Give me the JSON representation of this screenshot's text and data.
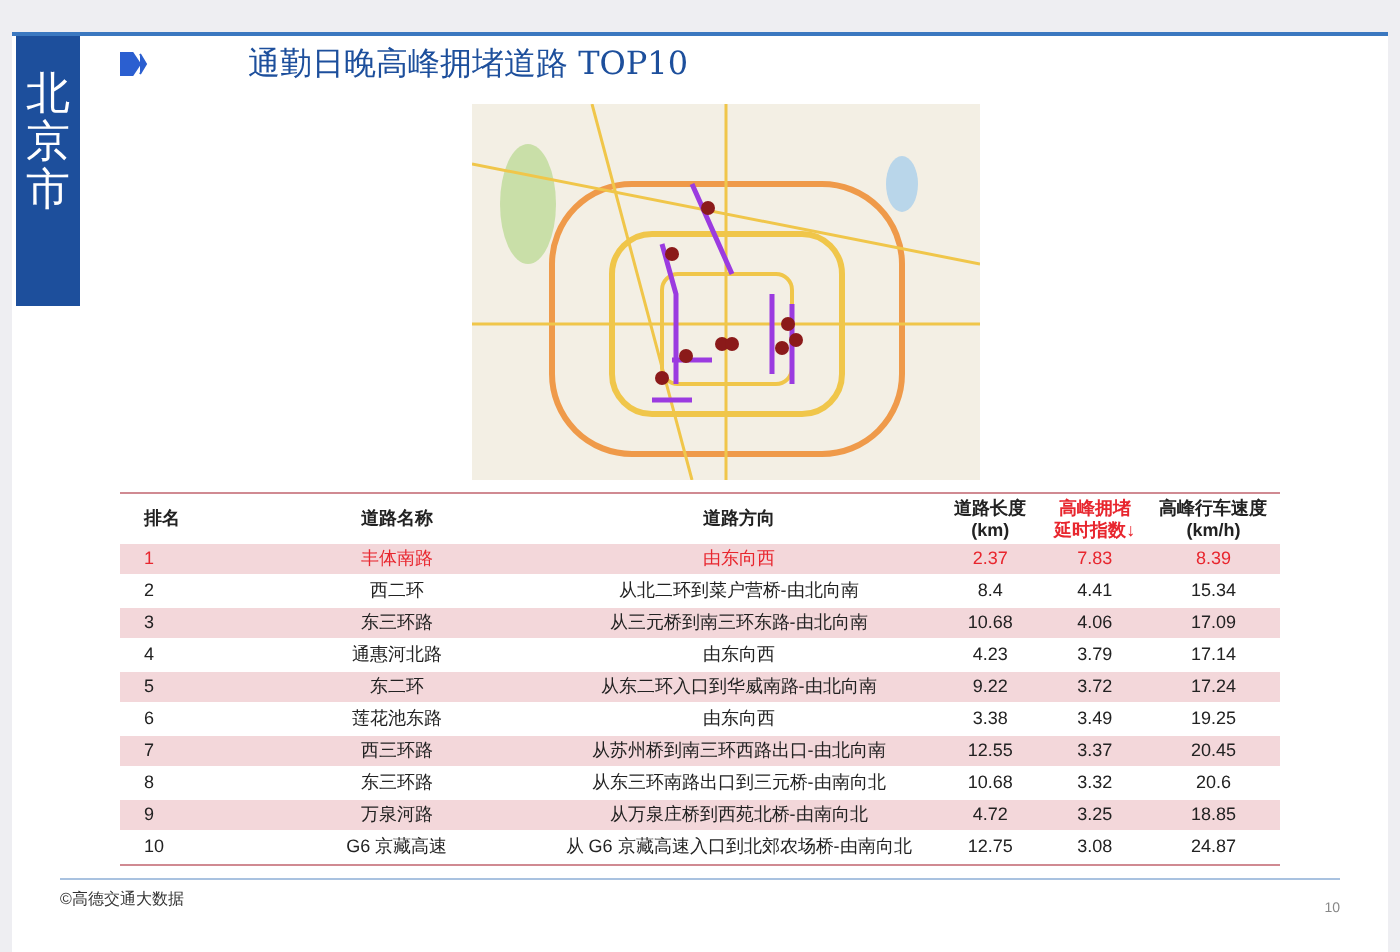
{
  "sidebar": {
    "city": "北京市"
  },
  "title": "通勤日晚高峰拥堵道路 TOP10",
  "table": {
    "columns": [
      {
        "lines": [
          "排名"
        ],
        "highlighted": false
      },
      {
        "lines": [
          "道路名称"
        ],
        "highlighted": false
      },
      {
        "lines": [
          "道路方向"
        ],
        "highlighted": false
      },
      {
        "lines": [
          "道路长度",
          "(km)"
        ],
        "highlighted": false
      },
      {
        "lines": [
          "高峰拥堵",
          "延时指数↓"
        ],
        "highlighted": true
      },
      {
        "lines": [
          "高峰行车速度",
          "(km/h)"
        ],
        "highlighted": false
      }
    ],
    "rows": [
      {
        "highlighted": true,
        "cells": [
          "1",
          "丰体南路",
          "由东向西",
          "2.37",
          "7.83",
          "8.39"
        ]
      },
      {
        "highlighted": false,
        "cells": [
          "2",
          "西二环",
          "从北二环到菜户营桥-由北向南",
          "8.4",
          "4.41",
          "15.34"
        ]
      },
      {
        "highlighted": false,
        "cells": [
          "3",
          "东三环路",
          "从三元桥到南三环东路-由北向南",
          "10.68",
          "4.06",
          "17.09"
        ]
      },
      {
        "highlighted": false,
        "cells": [
          "4",
          "通惠河北路",
          "由东向西",
          "4.23",
          "3.79",
          "17.14"
        ]
      },
      {
        "highlighted": false,
        "cells": [
          "5",
          "东二环",
          "从东二环入口到华威南路-由北向南",
          "9.22",
          "3.72",
          "17.24"
        ]
      },
      {
        "highlighted": false,
        "cells": [
          "6",
          "莲花池东路",
          "由东向西",
          "3.38",
          "3.49",
          "19.25"
        ]
      },
      {
        "highlighted": false,
        "cells": [
          "7",
          "西三环路",
          "从苏州桥到南三环西路出口-由北向南",
          "12.55",
          "3.37",
          "20.45"
        ]
      },
      {
        "highlighted": false,
        "cells": [
          "8",
          "东三环路",
          "从东三环南路出口到三元桥-由南向北",
          "10.68",
          "3.32",
          "20.6"
        ]
      },
      {
        "highlighted": false,
        "cells": [
          "9",
          "万泉河路",
          "从万泉庄桥到西苑北桥-由南向北",
          "4.72",
          "3.25",
          "18.85"
        ]
      },
      {
        "highlighted": false,
        "cells": [
          "10",
          "G6 京藏高速",
          "从 G6 京藏高速入口到北郊农场桥-由南向北",
          "12.75",
          "3.08",
          "24.87"
        ]
      }
    ]
  },
  "footer": {
    "source": "©高德交通大数据",
    "page": "10"
  }
}
